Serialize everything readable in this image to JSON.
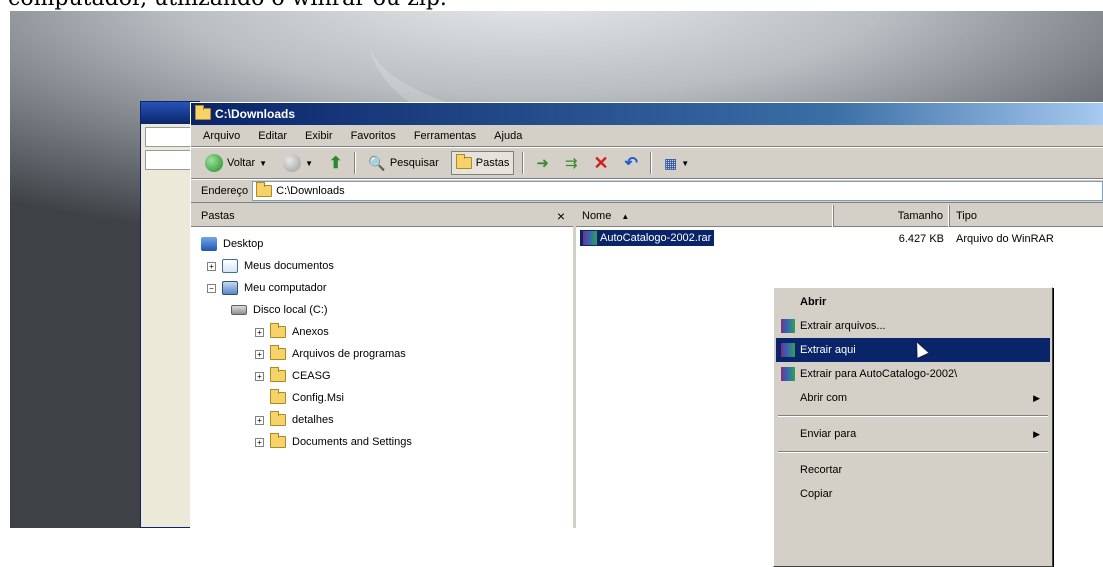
{
  "caption": "computador, utilizando o winrar ou zip.",
  "window": {
    "title": "C:\\Downloads",
    "menu": [
      "Arquivo",
      "Editar",
      "Exibir",
      "Favoritos",
      "Ferramentas",
      "Ajuda"
    ],
    "toolbar": {
      "back_label": "Voltar",
      "search_label": "Pesquisar",
      "folders_label": "Pastas"
    },
    "address": {
      "label": "Endereço",
      "value": "C:\\Downloads"
    }
  },
  "folders_pane": {
    "title": "Pastas",
    "close": "×",
    "tree": [
      {
        "label": "Desktop",
        "expander": "",
        "icon": "desktop-icon"
      },
      {
        "label": "Meus documentos",
        "expander": "+",
        "icon": "documents-icon"
      },
      {
        "label": "Meu computador",
        "expander": "−",
        "icon": "computer-icon"
      },
      {
        "label": "Disco local (C:)",
        "expander": "",
        "icon": "disk-icon"
      },
      {
        "label": "Anexos",
        "expander": "+",
        "icon": "folder-icon"
      },
      {
        "label": "Arquivos de programas",
        "expander": "+",
        "icon": "folder-icon"
      },
      {
        "label": "CEASG",
        "expander": "+",
        "icon": "folder-icon"
      },
      {
        "label": "Config.Msi",
        "expander": "",
        "icon": "folder-icon"
      },
      {
        "label": "detalhes",
        "expander": "+",
        "icon": "folder-icon"
      },
      {
        "label": "Documents and Settings",
        "expander": "+",
        "icon": "folder-icon"
      }
    ]
  },
  "file_list": {
    "columns": [
      "Nome",
      "Tamanho",
      "Tipo"
    ],
    "rows": [
      {
        "name": "AutoCatalogo-2002.rar",
        "size": "6.427 KB",
        "type": "Arquivo do WinRAR"
      }
    ]
  },
  "context_menu": {
    "items": [
      {
        "label": "Abrir",
        "bold": true
      },
      {
        "label": "Extrair arquivos...",
        "icon": true
      },
      {
        "label": "Extrair aqui",
        "icon": true,
        "highlighted": true
      },
      {
        "label": "Extrair para AutoCatalogo-2002\\",
        "icon": true
      },
      {
        "label": "Abrir com",
        "submenu": true
      },
      {
        "label": "Enviar para",
        "submenu": true
      },
      {
        "label": "Recortar"
      },
      {
        "label": "Copiar"
      }
    ]
  }
}
